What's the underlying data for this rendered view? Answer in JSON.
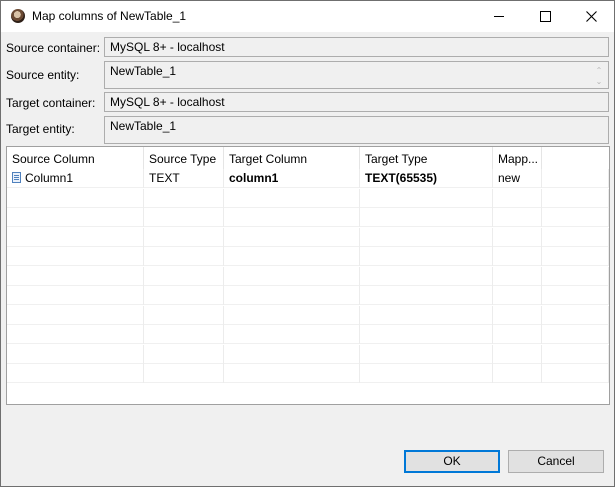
{
  "window": {
    "title": "Map columns of NewTable_1",
    "controls": {
      "minimize": "minimize-icon",
      "maximize": "maximize-icon",
      "close": "close-icon"
    }
  },
  "form": {
    "source_container": {
      "label": "Source container:",
      "value": "MySQL 8+ - localhost"
    },
    "source_entity": {
      "label": "Source entity:",
      "value": "NewTable_1"
    },
    "target_container": {
      "label": "Target container:",
      "value": "MySQL 8+ - localhost"
    },
    "target_entity": {
      "label": "Target entity:",
      "value": "NewTable_1"
    }
  },
  "grid": {
    "columns": [
      "Source Column",
      "Source Type",
      "Target Column",
      "Target Type",
      "Mapp..."
    ],
    "rows": [
      {
        "source_column": "Column1",
        "source_type": "TEXT",
        "target_column": "column1",
        "target_type": "TEXT(65535)",
        "mapping": "new"
      },
      {},
      {},
      {},
      {},
      {},
      {},
      {},
      {},
      {},
      {}
    ]
  },
  "buttons": {
    "ok": "OK",
    "cancel": "Cancel"
  },
  "colors": {
    "ok_border": "#0078d7",
    "field_border": "#adadad",
    "dialog_bg": "#f0f0f0"
  }
}
